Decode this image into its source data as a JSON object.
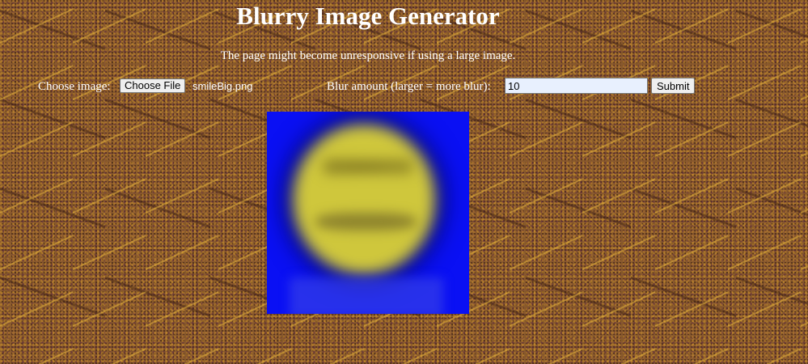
{
  "page": {
    "title": "Blurry Image Generator",
    "warning": "The page might become unresponsive if using a large image."
  },
  "form": {
    "choose_label": "Choose image:",
    "file_button_label": "Choose File",
    "file_name": "smileBig.png",
    "blur_label": "Blur amount (larger = more blur):",
    "blur_value": "10",
    "submit_label": "Submit"
  },
  "output": {
    "background_color": "#0a10f4",
    "face_color": "#cfc73c",
    "image_icon": "blurred-smiley-image"
  }
}
